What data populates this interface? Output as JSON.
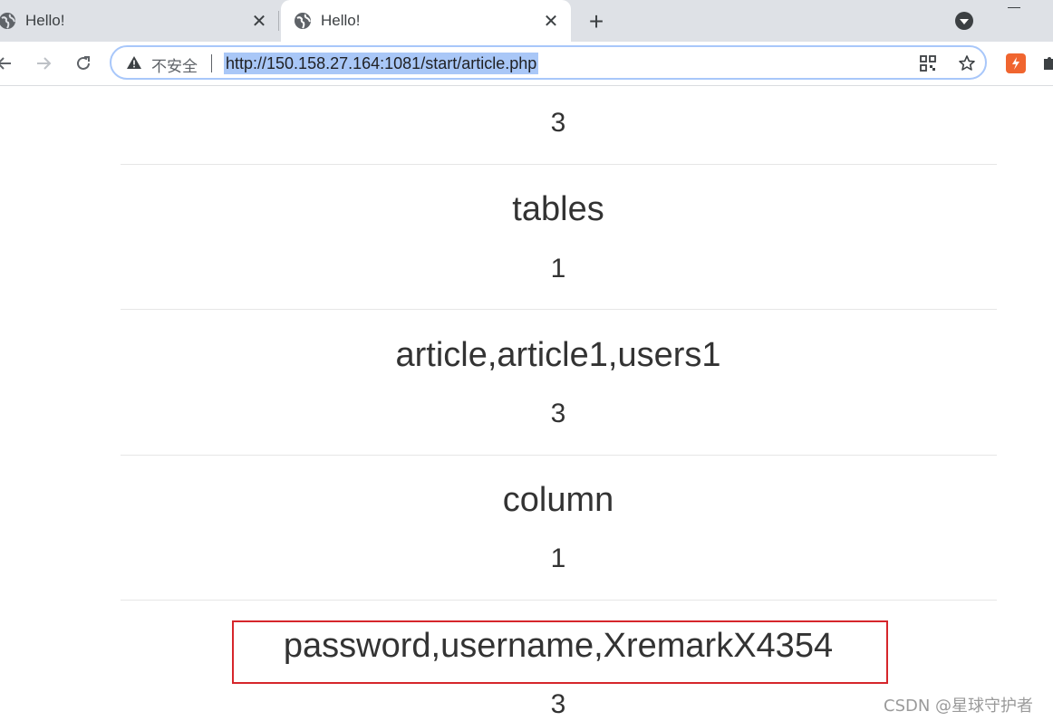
{
  "tabs": [
    {
      "title": "Hello!",
      "active": false
    },
    {
      "title": "Hello!",
      "active": true
    }
  ],
  "toolbar": {
    "security_label": "不安全",
    "url": "http://150.158.27.164:1081/start/article.php"
  },
  "page": {
    "top_value": "3",
    "sections": [
      {
        "title": "tables",
        "value": "1"
      },
      {
        "title": "article,article1,users1",
        "value": "3"
      },
      {
        "title": "column",
        "value": "1"
      },
      {
        "title": "password,username,XremarkX4354",
        "value": "3"
      }
    ]
  },
  "watermark": "CSDN @星球守护者",
  "colors": {
    "highlight_border": "#d6262b",
    "url_selection": "#a9c7f7",
    "omnibox_focus": "#a8c7fa",
    "extension_orange": "#f0652f"
  }
}
